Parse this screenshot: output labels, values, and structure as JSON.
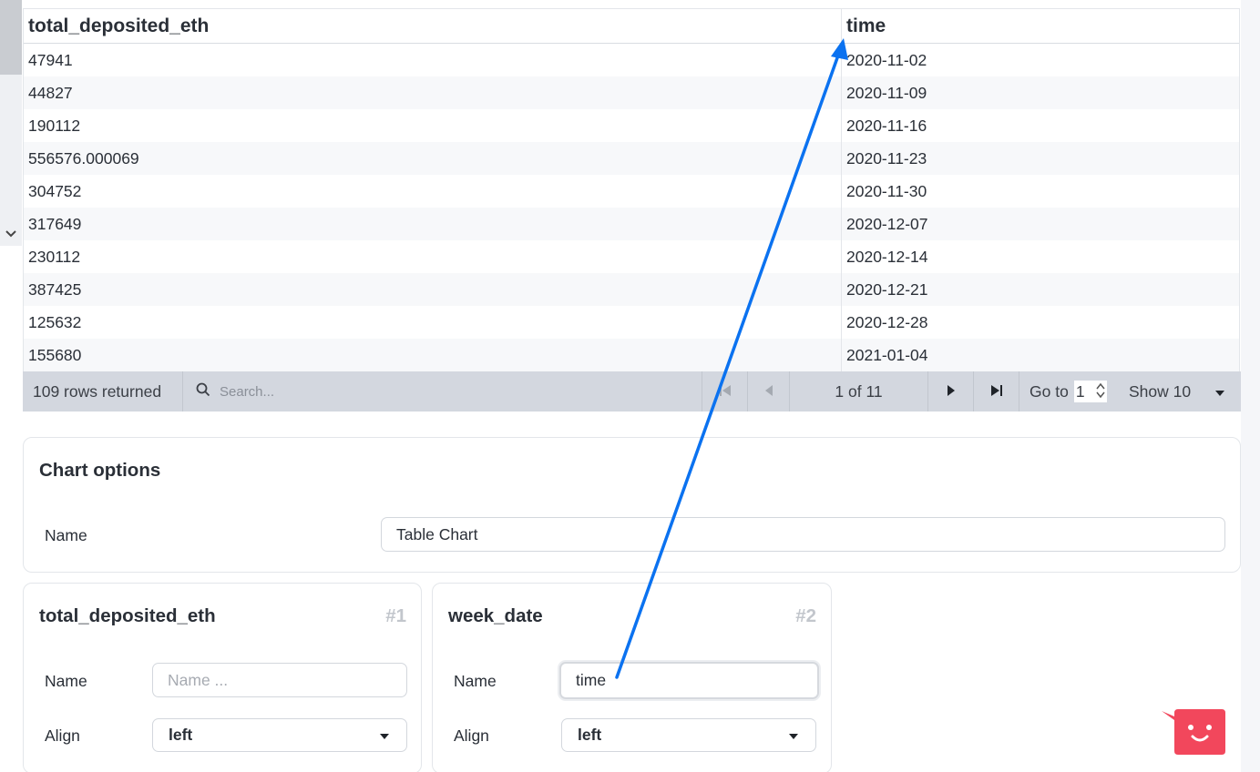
{
  "table": {
    "columns": [
      "total_deposited_eth",
      "time"
    ],
    "rows": [
      [
        "47941",
        "2020-11-02"
      ],
      [
        "44827",
        "2020-11-09"
      ],
      [
        "190112",
        "2020-11-16"
      ],
      [
        "556576.000069",
        "2020-11-23"
      ],
      [
        "304752",
        "2020-11-30"
      ],
      [
        "317649",
        "2020-12-07"
      ],
      [
        "230112",
        "2020-12-14"
      ],
      [
        "387425",
        "2020-12-21"
      ],
      [
        "125632",
        "2020-12-28"
      ],
      [
        "155680",
        "2021-01-04"
      ]
    ]
  },
  "footer": {
    "rows_returned": "109 rows returned",
    "search_placeholder": "Search...",
    "page_indicator": "1 of 11",
    "goto_label": "Go to",
    "goto_value": "1",
    "show_label": "Show 10"
  },
  "chart_options": {
    "title": "Chart options",
    "name_label": "Name",
    "name_value": "Table Chart"
  },
  "column_settings": [
    {
      "title": "total_deposited_eth",
      "index": "#1",
      "name_label": "Name",
      "name_value": "",
      "name_placeholder": "Name ...",
      "align_label": "Align",
      "align_value": "left"
    },
    {
      "title": "week_date",
      "index": "#2",
      "name_label": "Name",
      "name_value": "time",
      "name_placeholder": "",
      "align_label": "Align",
      "align_value": "left"
    }
  ],
  "colors": {
    "accent_arrow": "#0b72f0",
    "chat_bubble": "#f2475c",
    "footer_bg": "#d3d7df"
  },
  "icons": {
    "search": "search-icon",
    "first_page": "first-page-icon",
    "prev_page": "prev-page-icon",
    "next_page": "next-page-icon",
    "last_page": "last-page-icon",
    "caret": "caret-down-icon",
    "chat": "chat-bot-icon"
  }
}
